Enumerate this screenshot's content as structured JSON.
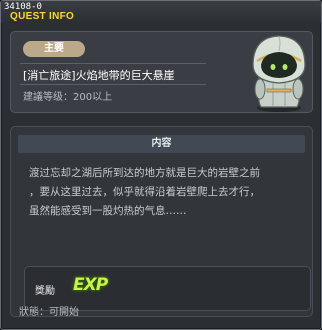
{
  "window": {
    "quest_id": "34108-0",
    "title": "QUEST INFO"
  },
  "quest": {
    "type_badge": "主要",
    "name": "[消亡旅途]火焰地带的巨大悬崖",
    "level_requirement": "建議等级：200以上"
  },
  "content": {
    "header": "内容",
    "description_lines": [
      "渡过忘却之湖后所到达的地方就是巨大的岩壁之前",
      "，要从这里过去，似乎就得沿着岩壁爬上去才行，",
      "虽然能感受到一股灼热的气息……"
    ]
  },
  "reward": {
    "label": "獎勵",
    "icon": "exp-icon",
    "icon_text": "EXP"
  },
  "status": {
    "text": "狀態：可開始"
  },
  "colors": {
    "title": "#ffd633",
    "badge": "#bba98a",
    "exp": "#c9f24b"
  }
}
